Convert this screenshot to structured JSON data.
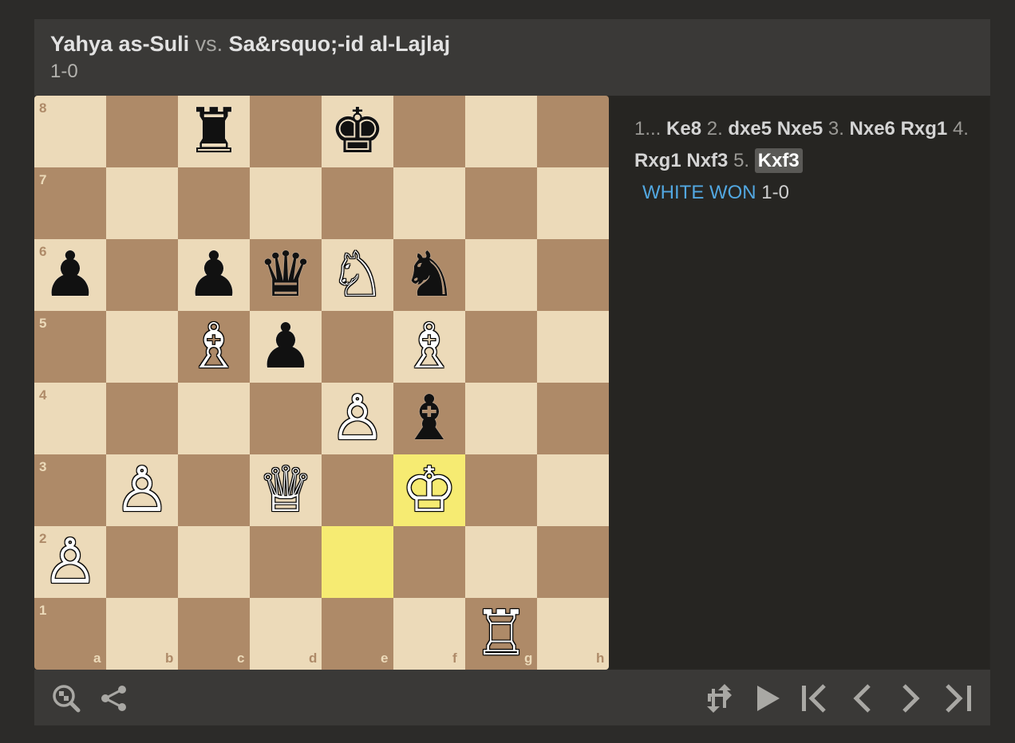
{
  "header": {
    "white_player": "Yahya as-Suli",
    "vs": "vs.",
    "black_player": "Sa&rsquo;-id al-Lajlaj",
    "result": "1-0"
  },
  "board": {
    "colors": {
      "light": "#ecdab9",
      "dark": "#ae8a68",
      "highlight": "#f6eb72",
      "highlight_dark": "#f5e46c"
    },
    "files": [
      "a",
      "b",
      "c",
      "d",
      "e",
      "f",
      "g",
      "h"
    ],
    "ranks": [
      "8",
      "7",
      "6",
      "5",
      "4",
      "3",
      "2",
      "1"
    ],
    "highlighted_squares": [
      "e2",
      "f3"
    ],
    "pieces": [
      {
        "square": "c8",
        "color": "black",
        "type": "rook",
        "glyph": "♜"
      },
      {
        "square": "e8",
        "color": "black",
        "type": "king",
        "glyph": "♚"
      },
      {
        "square": "a6",
        "color": "black",
        "type": "pawn",
        "glyph": "♟"
      },
      {
        "square": "c6",
        "color": "black",
        "type": "pawn",
        "glyph": "♟"
      },
      {
        "square": "d6",
        "color": "black",
        "type": "queen",
        "glyph": "♛"
      },
      {
        "square": "e6",
        "color": "white",
        "type": "knight",
        "glyph": "♘"
      },
      {
        "square": "f6",
        "color": "black",
        "type": "knight",
        "glyph": "♞"
      },
      {
        "square": "c5",
        "color": "white",
        "type": "bishop",
        "glyph": "♗"
      },
      {
        "square": "d5",
        "color": "black",
        "type": "pawn",
        "glyph": "♟"
      },
      {
        "square": "f5",
        "color": "white",
        "type": "bishop",
        "glyph": "♗"
      },
      {
        "square": "e4",
        "color": "white",
        "type": "pawn",
        "glyph": "♙"
      },
      {
        "square": "f4",
        "color": "black",
        "type": "bishop",
        "glyph": "♝"
      },
      {
        "square": "b3",
        "color": "white",
        "type": "pawn",
        "glyph": "♙"
      },
      {
        "square": "d3",
        "color": "white",
        "type": "queen",
        "glyph": "♕"
      },
      {
        "square": "f3",
        "color": "white",
        "type": "king",
        "glyph": "♔"
      },
      {
        "square": "a2",
        "color": "white",
        "type": "pawn",
        "glyph": "♙"
      },
      {
        "square": "g1",
        "color": "white",
        "type": "rook",
        "glyph": "♖"
      }
    ]
  },
  "moves": {
    "items": [
      {
        "num": "1...",
        "san": "Ke8"
      },
      {
        "num": "2.",
        "san": "dxe5"
      },
      {
        "num": "",
        "san": "Nxe5"
      },
      {
        "num": "3.",
        "san": "Nxe6"
      },
      {
        "num": "",
        "san": "Rxg1"
      },
      {
        "num": "4.",
        "san": "Rxg1"
      },
      {
        "num": "",
        "san": "Nxf3"
      },
      {
        "num": "5.",
        "san": "Kxf3",
        "current": true
      }
    ],
    "outcome": "WHITE WON",
    "score": "1-0"
  },
  "toolbar": {
    "left": [
      {
        "name": "analysis-board-button",
        "icon": "magnifier-chess-icon"
      },
      {
        "name": "share-button",
        "icon": "share-icon"
      }
    ],
    "right": [
      {
        "name": "flip-board-button",
        "icon": "flip-icon"
      },
      {
        "name": "play-button",
        "icon": "play-icon"
      },
      {
        "name": "first-move-button",
        "icon": "skip-start-icon"
      },
      {
        "name": "previous-move-button",
        "icon": "chevron-left-icon"
      },
      {
        "name": "next-move-button",
        "icon": "chevron-right-icon"
      },
      {
        "name": "last-move-button",
        "icon": "skip-end-icon"
      }
    ]
  }
}
